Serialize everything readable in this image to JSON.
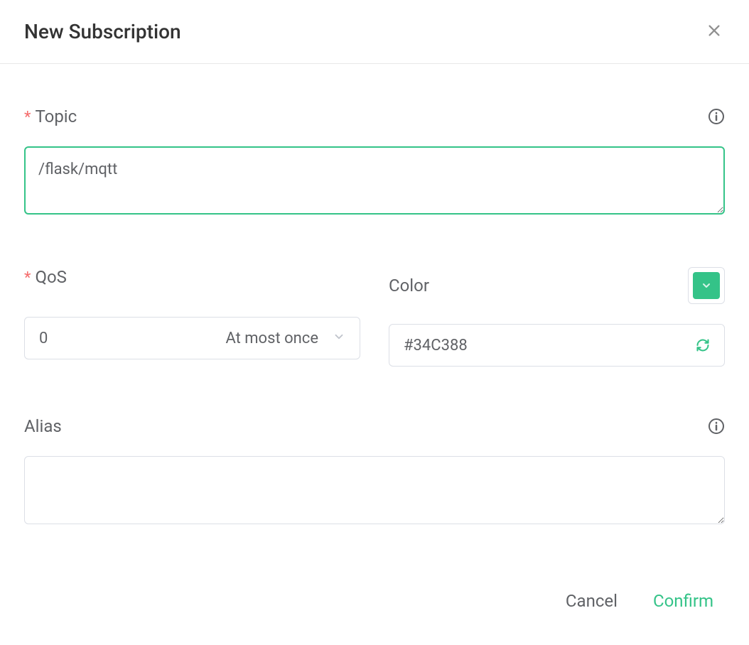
{
  "header": {
    "title": "New Subscription"
  },
  "form": {
    "topic": {
      "label": "Topic",
      "required": true,
      "value": "/flask/mqtt"
    },
    "qos": {
      "label": "QoS",
      "required": true,
      "value": "0",
      "description": "At most once"
    },
    "color": {
      "label": "Color",
      "value": "#34C388",
      "swatch_color": "#34c388"
    },
    "alias": {
      "label": "Alias",
      "value": ""
    }
  },
  "footer": {
    "cancel_label": "Cancel",
    "confirm_label": "Confirm"
  }
}
